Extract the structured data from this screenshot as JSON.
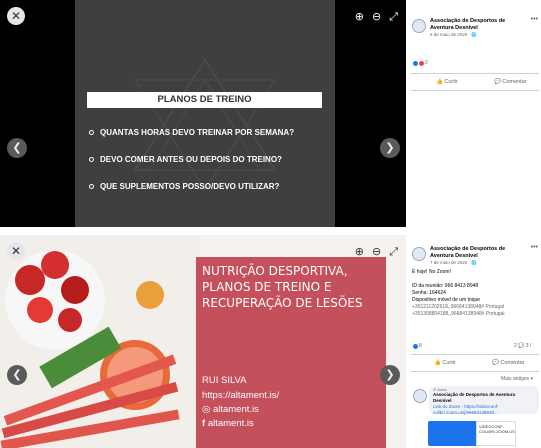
{
  "panel1": {
    "slide": {
      "title": "PLANOS DE TREINO",
      "bullets": [
        "QUANTAS HORAS DEVO TREINAR POR SEMANA?",
        "DEVO COMER ANTES OU DEPOIS DO TREINO?",
        "QUE SUPLEMENTOS POSSO/DEVO UTILIZAR?"
      ]
    },
    "post": {
      "page_name": "Associação de Desportos de Aventura Desnível",
      "date": "5 de maio de 2020 · 🌐",
      "reaction_count": "2",
      "like_label": "Curtir",
      "comment_label": "Comentar"
    }
  },
  "panel2": {
    "slide": {
      "title": "NUTRIÇÃO DESPORTIVA, PLANOS DE TREINO E RECUPERAÇÃO DE LESÕES",
      "author": "RUI SILVA",
      "url": "https://altament.is/",
      "instagram": "altament.is",
      "facebook": "altament.is"
    },
    "post": {
      "page_name": "Associação de Desportos de Aventura Desnível",
      "date": "7 de maio de 2020 · 🌐",
      "lines": [
        "É hoje! No Zoom!",
        "",
        "ID da reunião: 966 8413 8948",
        "Senha: 164624",
        "Dispositivo móvel de um toque",
        "+351211202618,,96684138948# Portugal",
        "+351308804188,,96684138948# Portugal"
      ],
      "reaction_count": "8",
      "comment_count": "2 💬 3 /",
      "like_label": "Curtir",
      "comment_label": "Comentar",
      "more_comments": "Mais antigos ▾",
      "comment_author_prefix": "✐ Autor",
      "comment_author": "Associação de Desportos de Aventura Desnível",
      "comment_text": "Link do Zoom - https://videoconf-colibri.zoom.us/j/96684138948...",
      "card_text": "VIDEOCONF-COLIBRI.ZOOM.US"
    }
  }
}
